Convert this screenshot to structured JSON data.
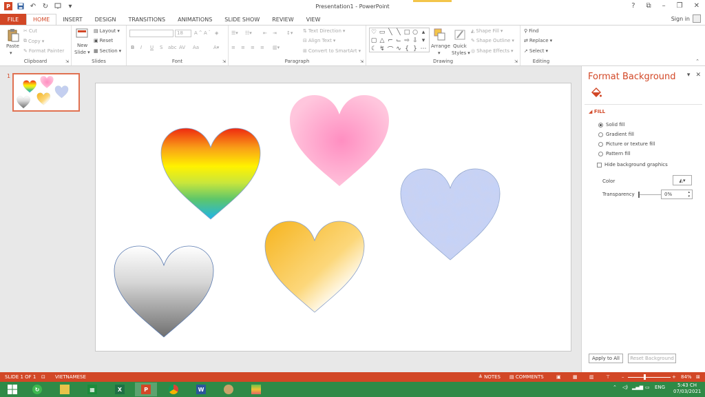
{
  "window": {
    "title": "Presentation1 - PowerPoint",
    "help": "?",
    "ribbon_display": "⧉",
    "minimize": "–",
    "maximize": "❐",
    "close": "✕"
  },
  "tabs": [
    {
      "label": "FILE"
    },
    {
      "label": "HOME"
    },
    {
      "label": "INSERT"
    },
    {
      "label": "DESIGN"
    },
    {
      "label": "TRANSITIONS"
    },
    {
      "label": "ANIMATIONS"
    },
    {
      "label": "SLIDE SHOW"
    },
    {
      "label": "REVIEW"
    },
    {
      "label": "VIEW"
    }
  ],
  "signin": "Sign in",
  "ribbon": {
    "clipboard": {
      "name": "Clipboard",
      "paste": "Paste",
      "cut": "Cut",
      "copy": "Copy",
      "format_painter": "Format Painter"
    },
    "slides": {
      "name": "Slides",
      "new_slide_line1": "New",
      "new_slide_line2": "Slide",
      "layout": "Layout",
      "reset": "Reset",
      "section": "Section"
    },
    "font": {
      "name": "Font",
      "size": "18"
    },
    "paragraph": {
      "name": "Paragraph",
      "text_direction": "Text Direction",
      "align_text": "Align Text",
      "convert_smartart": "Convert to SmartArt"
    },
    "drawing": {
      "name": "Drawing",
      "arrange": "Arrange",
      "quick_styles_line1": "Quick",
      "quick_styles_line2": "Styles",
      "shape_fill": "Shape Fill",
      "shape_outline": "Shape Outline",
      "shape_effects": "Shape Effects"
    },
    "editing": {
      "name": "Editing",
      "find": "Find",
      "replace": "Replace",
      "select": "Select"
    }
  },
  "slide_panel": {
    "slide_number": "1"
  },
  "format_background": {
    "title": "Format Background",
    "section": "FILL",
    "options": [
      {
        "label": "Solid fill",
        "selected": true
      },
      {
        "label": "Gradient fill",
        "selected": false
      },
      {
        "label": "Picture or texture fill",
        "selected": false
      },
      {
        "label": "Pattern fill",
        "selected": false
      }
    ],
    "hide_background": "Hide background graphics",
    "color_label": "Color",
    "transparency_label": "Transparency",
    "transparency_value": "0%",
    "apply_all": "Apply to All",
    "reset_background": "Reset Background"
  },
  "status": {
    "slide_indicator": "SLIDE 1 OF 1",
    "language": "VIETNAMESE",
    "notes": "NOTES",
    "comments": "COMMENTS",
    "zoom": "84%",
    "zoom_minus": "–",
    "zoom_plus": "+"
  },
  "taskbar": {
    "language": "ENG",
    "time": "5:43 CH",
    "date": "07/03/2021"
  },
  "colors": {
    "accent": "#d24726",
    "taskbar": "#2f8a47"
  }
}
